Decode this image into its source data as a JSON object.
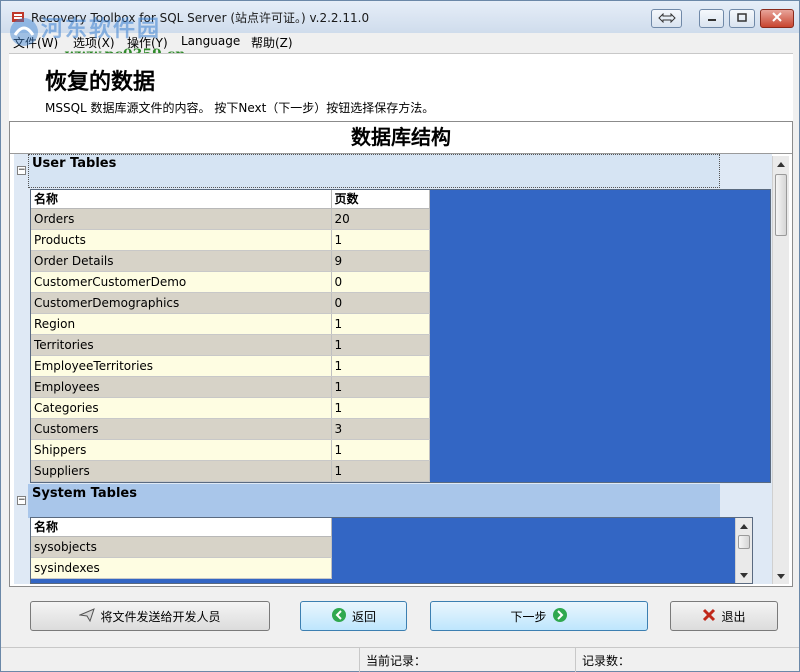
{
  "window": {
    "title": "Recovery Toolbox for SQL Server (站点许可证。) v.2.2.11.0"
  },
  "watermark": {
    "title": "河东软件园",
    "url": "www.pc0359.cn"
  },
  "menu": [
    "文件(W)",
    "选项(X)",
    "操作(Y)",
    "Language",
    "帮助(Z)"
  ],
  "header": {
    "title": "恢复的数据",
    "subtitle": "MSSQL 数据库源文件的内容。 按下Next（下一步）按钮选择保存方法。"
  },
  "panel": {
    "title": "数据库结构"
  },
  "user_tables": {
    "section_label": "User Tables",
    "columns": [
      "名称",
      "页数"
    ],
    "rows": [
      {
        "name": "Orders",
        "pages": "20"
      },
      {
        "name": "Products",
        "pages": "1"
      },
      {
        "name": "Order Details",
        "pages": "9"
      },
      {
        "name": "CustomerCustomerDemo",
        "pages": "0"
      },
      {
        "name": "CustomerDemographics",
        "pages": "0"
      },
      {
        "name": "Region",
        "pages": "1"
      },
      {
        "name": "Territories",
        "pages": "1"
      },
      {
        "name": "EmployeeTerritories",
        "pages": "1"
      },
      {
        "name": "Employees",
        "pages": "1"
      },
      {
        "name": "Categories",
        "pages": "1"
      },
      {
        "name": "Customers",
        "pages": "3"
      },
      {
        "name": "Shippers",
        "pages": "1"
      },
      {
        "name": "Suppliers",
        "pages": "1"
      }
    ]
  },
  "system_tables": {
    "section_label": "System Tables",
    "columns": [
      "名称"
    ],
    "rows": [
      {
        "name": "sysobjects"
      },
      {
        "name": "sysindexes"
      }
    ]
  },
  "buttons": {
    "send": "将文件发送给开发人员",
    "back": "返回",
    "next": "下一步",
    "exit": "退出"
  },
  "status": {
    "current_record": "当前记录：",
    "record_count": "记录数："
  },
  "colors": {
    "grid_fill": "#3366c4",
    "row_odd": "#d7d3c8",
    "row_even": "#fefde2",
    "section_bg": "#dfe9f5"
  }
}
